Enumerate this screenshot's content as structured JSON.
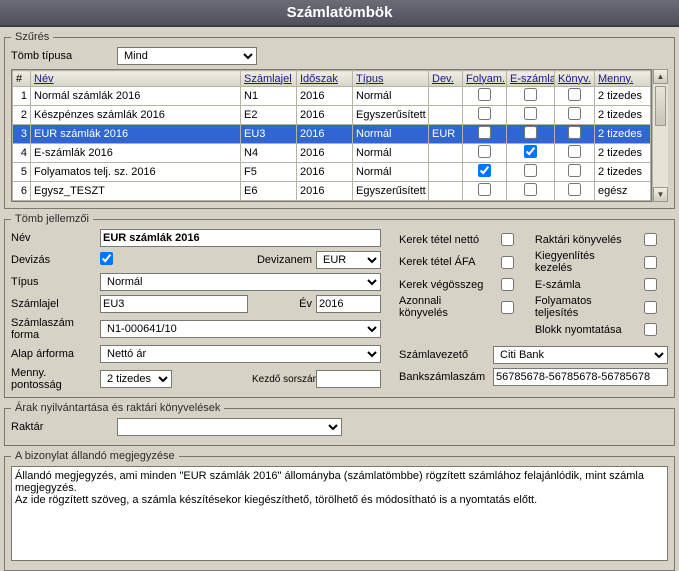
{
  "title": "Számlatömbök",
  "filter": {
    "legend": "Szűrés",
    "type_label": "Tömb típusa",
    "type_value": "Mind"
  },
  "grid": {
    "headers": {
      "num": "#",
      "nev": "Név",
      "szamlajel": "Számlajel",
      "idoszak": "Időszak",
      "tipus": "Típus",
      "dev": "Dev.",
      "folyam": "Folyam.",
      "eszamla": "E-számla",
      "konyv": "Könyv.",
      "menny": "Menny."
    },
    "rows": [
      {
        "n": "1",
        "nev": "Normál számlák 2016",
        "sj": "N1",
        "ido": "2016",
        "tip": "Normál",
        "dev": "",
        "f": false,
        "e": false,
        "k": false,
        "m": "2 tizedes",
        "sel": false
      },
      {
        "n": "2",
        "nev": "Készpénzes számlák 2016",
        "sj": "E2",
        "ido": "2016",
        "tip": "Egyszerűsített",
        "dev": "",
        "f": false,
        "e": false,
        "k": false,
        "m": "2 tizedes",
        "sel": false
      },
      {
        "n": "3",
        "nev": "EUR számlák 2016",
        "sj": "EU3",
        "ido": "2016",
        "tip": "Normál",
        "dev": "EUR",
        "f": false,
        "e": false,
        "k": false,
        "m": "2 tizedes",
        "sel": true
      },
      {
        "n": "4",
        "nev": "E-számlák 2016",
        "sj": "N4",
        "ido": "2016",
        "tip": "Normál",
        "dev": "",
        "f": false,
        "e": true,
        "k": false,
        "m": "2 tizedes",
        "sel": false
      },
      {
        "n": "5",
        "nev": "Folyamatos telj. sz. 2016",
        "sj": "F5",
        "ido": "2016",
        "tip": "Normál",
        "dev": "",
        "f": true,
        "e": false,
        "k": false,
        "m": "2 tizedes",
        "sel": false
      },
      {
        "n": "6",
        "nev": "Egysz_TESZT",
        "sj": "E6",
        "ido": "2016",
        "tip": "Egyszerűsített",
        "dev": "",
        "f": false,
        "e": false,
        "k": false,
        "m": "egész",
        "sel": false
      }
    ]
  },
  "details": {
    "legend": "Tömb jellemzői",
    "nev_label": "Név",
    "nev_value": "EUR számlák 2016",
    "devizas_label": "Devizás",
    "devizas_checked": true,
    "devizanem_label": "Devizanem",
    "devizanem_value": "EUR",
    "tipus_label": "Típus",
    "tipus_value": "Normál",
    "szamlajel_label": "Számlajel",
    "szamlajel_value": "EU3",
    "ev_label": "Év",
    "ev_value": "2016",
    "szamlaszamforma_label": "Számlaszám forma",
    "szamlaszamforma_value": "N1-000641/10",
    "alaparforma_label": "Alap árforma",
    "alaparforma_value": "Nettó ár",
    "mennypont_label": "Menny. pontosság",
    "mennypont_value": "2 tizedes",
    "kezdosor_label": "Kezdő sorszám",
    "kezdosor_value": "",
    "flags": {
      "kerek_netto": "Kerek tétel nettó",
      "kerek_afa": "Kerek tétel ÁFA",
      "kerek_vegosszeg": "Kerek végösszeg",
      "azonnali": "Azonnali könyvelés",
      "raktari": "Raktári könyvelés",
      "kiegyenlites": "Kiegyenlítés kezelés",
      "eszamla": "E-számla",
      "folyamatos": "Folyamatos teljesítés",
      "blokk": "Blokk nyomtatása"
    },
    "szamlavezeto_label": "Számlavezető",
    "szamlavezeto_value": "Citi Bank",
    "bankszamla_label": "Bankszámlaszám",
    "bankszamla_value": "56785678-56785678-56785678"
  },
  "stock": {
    "legend": "Árak nyilvántartása és raktári könyvelések",
    "raktar_label": "Raktár",
    "raktar_value": ""
  },
  "note": {
    "legend": "A bizonylat állandó megjegyzése",
    "text": "Állandó megjegyzés, ami minden \"EUR számlák 2016\" állományba (számlatömbbe) rögzített számlához felajánlódik, mint számla megjegyzés.\nAz ide rögzített szöveg, a számla készítésekor kiegészíthető, törölhető és módosítható is a nyomtatás előtt."
  }
}
